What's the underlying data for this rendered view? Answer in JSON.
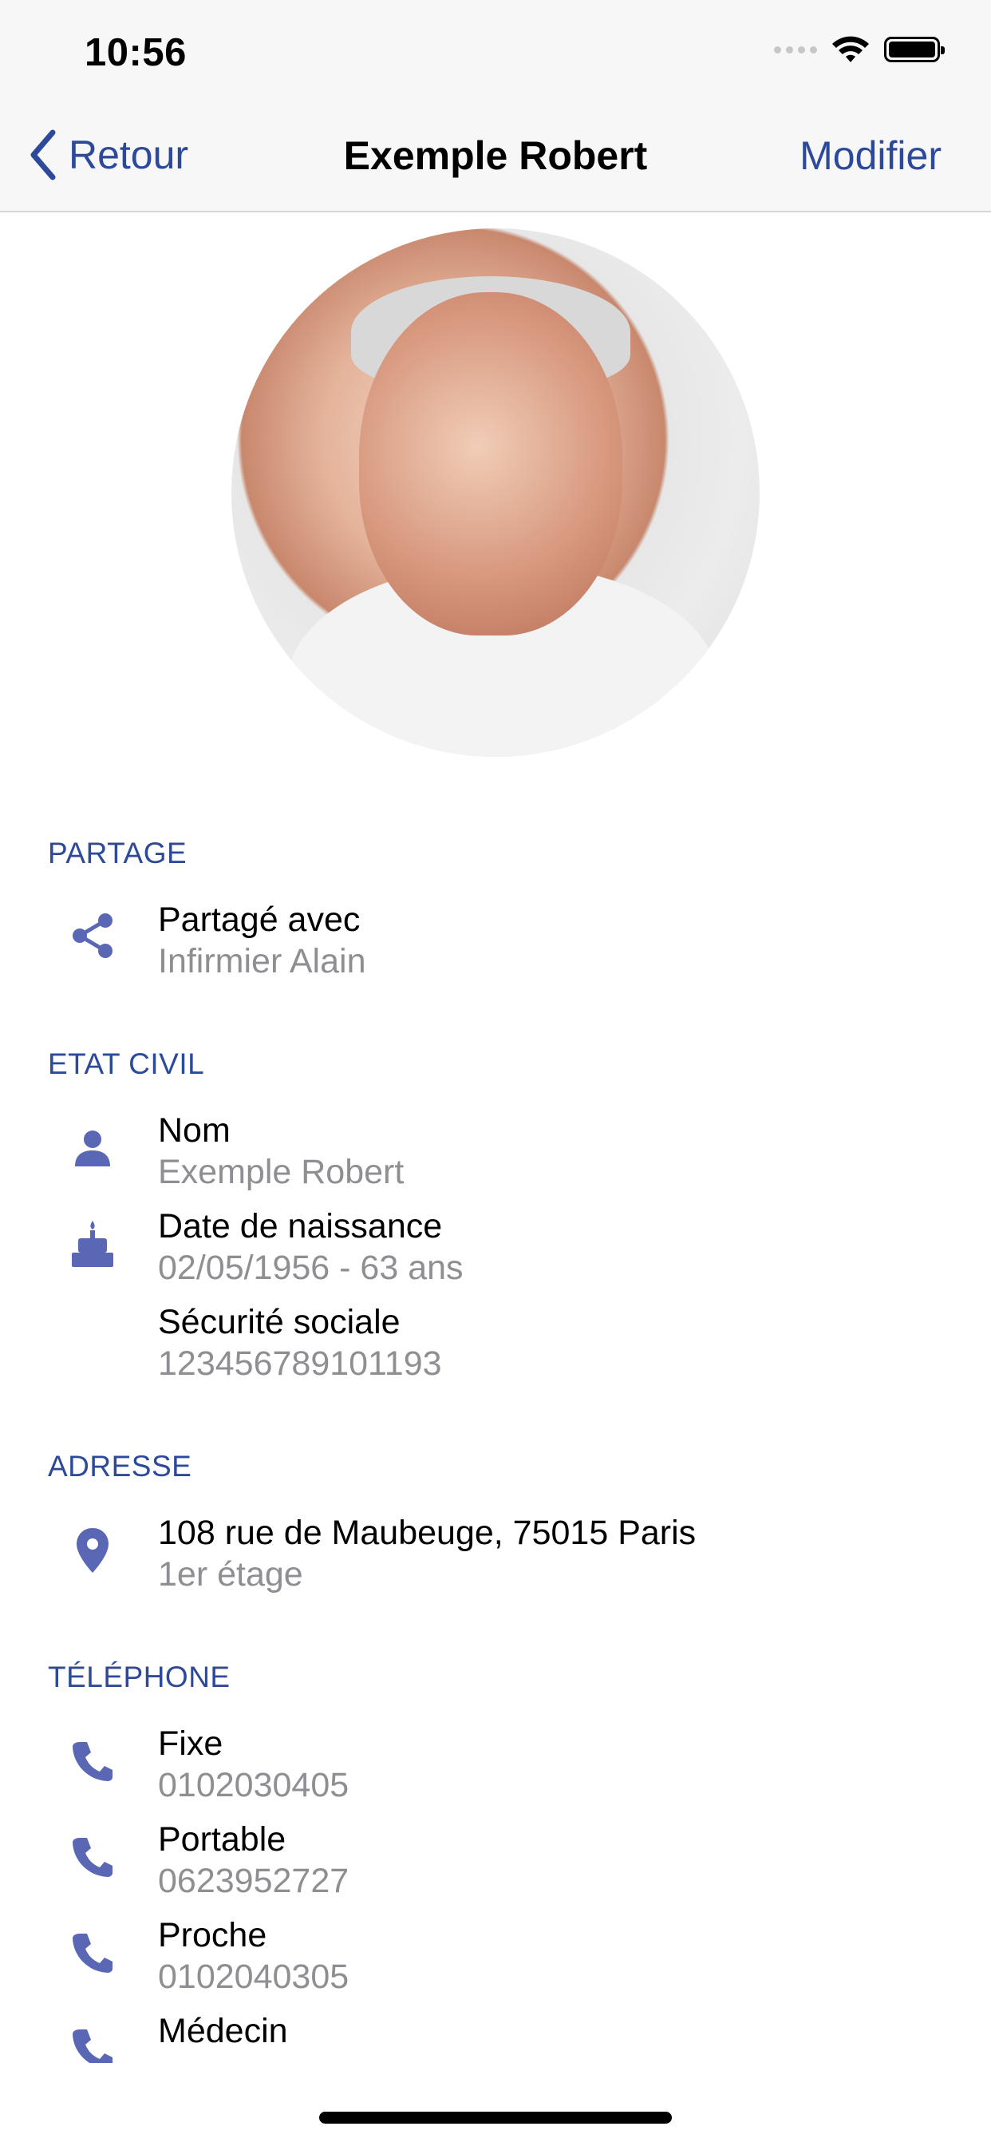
{
  "status": {
    "time": "10:56"
  },
  "nav": {
    "back_label": "Retour",
    "title": "Exemple Robert",
    "edit_label": "Modifier"
  },
  "sections": {
    "partage": {
      "label": "PARTAGE",
      "items": [
        {
          "icon": "share-icon",
          "title": "Partagé avec",
          "value": "Infirmier Alain"
        }
      ]
    },
    "etat_civil": {
      "label": "ETAT CIVIL",
      "items": [
        {
          "icon": "person-icon",
          "title": "Nom",
          "value": "Exemple Robert"
        },
        {
          "icon": "birthday-cake-icon",
          "title": "Date de naissance",
          "value": "02/05/1956 - 63 ans"
        },
        {
          "icon": "",
          "title": "Sécurité sociale",
          "value": "123456789101193"
        }
      ]
    },
    "adresse": {
      "label": "ADRESSE",
      "items": [
        {
          "icon": "location-pin-icon",
          "title": "108 rue de Maubeuge, 75015 Paris",
          "value": "1er étage"
        }
      ]
    },
    "telephone": {
      "label": "TÉLÉPHONE",
      "items": [
        {
          "icon": "phone-icon",
          "title": "Fixe",
          "value": "0102030405"
        },
        {
          "icon": "phone-icon",
          "title": "Portable",
          "value": "0623952727"
        },
        {
          "icon": "phone-icon",
          "title": "Proche",
          "value": "0102040305"
        },
        {
          "icon": "phone-icon",
          "title": "Médecin",
          "value": ""
        }
      ]
    }
  },
  "colors": {
    "accent": "#2d4a9a",
    "icon": "#5a67b5",
    "secondary_text": "#8e8e93",
    "nav_background": "#f7f7f7"
  }
}
